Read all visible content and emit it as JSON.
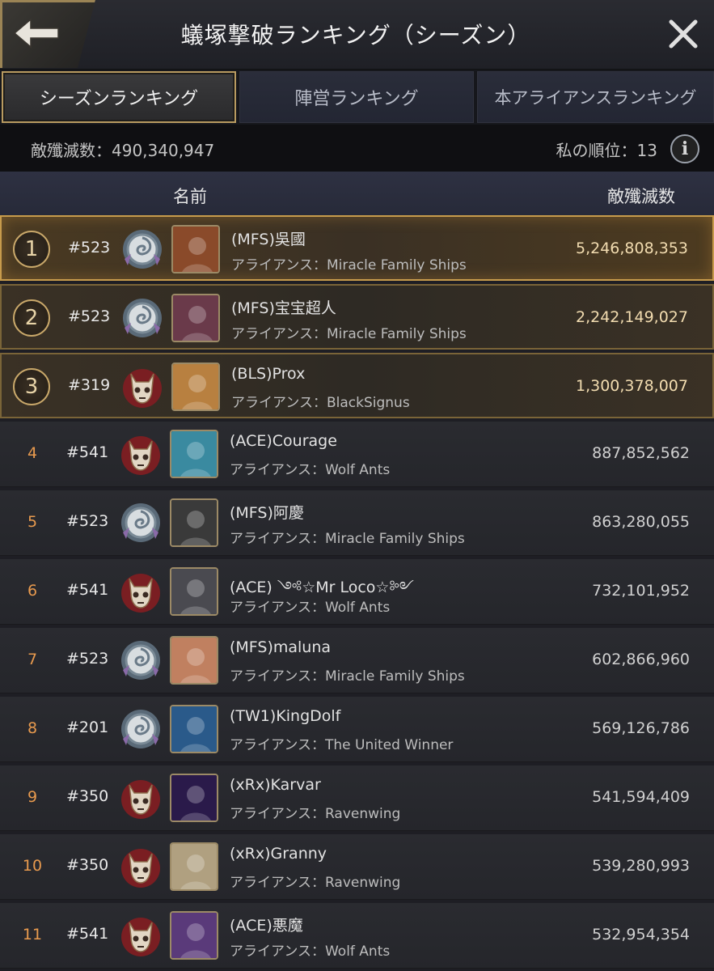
{
  "header": {
    "title": "蟻塚撃破ランキング（シーズン）",
    "back_icon": "arrow-left-icon",
    "close_icon": "close-icon"
  },
  "tabs": [
    {
      "label": "シーズンランキング",
      "active": true
    },
    {
      "label": "陣営ランキング",
      "active": false
    },
    {
      "label": "本アライアンスランキング",
      "active": false
    }
  ],
  "summary": {
    "kills_total": "敵殲滅数：490,340,947",
    "my_rank": "私の順位：13",
    "info_icon_text": "i"
  },
  "columns": {
    "name": "名前",
    "kills": "敵殲滅数"
  },
  "rows": [
    {
      "rank": "1",
      "server": "#523",
      "badge": "shell",
      "avatar_color": "#8a4a2a",
      "name": "(MFS)吳國",
      "alliance": "アライアンス：Miracle Family Ships",
      "kills": "5,246,808,353"
    },
    {
      "rank": "2",
      "server": "#523",
      "badge": "shell",
      "avatar_color": "#6a3a4a",
      "name": "(MFS)宝宝超人",
      "alliance": "アライアンス：Miracle Family Ships",
      "kills": "2,242,149,027"
    },
    {
      "rank": "3",
      "server": "#319",
      "badge": "skull",
      "avatar_color": "#b88040",
      "name": "(BLS)Prox",
      "alliance": "アライアンス：BlackSignus",
      "kills": "1,300,378,007"
    },
    {
      "rank": "4",
      "server": "#541",
      "badge": "skull",
      "avatar_color": "#3a8aa0",
      "name": "(ACE)Courage",
      "alliance": "アライアンス：Wolf Ants",
      "kills": "887,852,562"
    },
    {
      "rank": "5",
      "server": "#523",
      "badge": "shell",
      "avatar_color": "#3a3a3a",
      "name": "(MFS)阿慶",
      "alliance": "アライアンス：Miracle Family Ships",
      "kills": "863,280,055"
    },
    {
      "rank": "6",
      "server": "#541",
      "badge": "skull",
      "avatar_color": "#4a4a50",
      "name": "(ACE) ༺☆Mr Loco☆༻",
      "alliance": "アライアンス：Wolf Ants",
      "kills": "732,101,952"
    },
    {
      "rank": "7",
      "server": "#523",
      "badge": "shell",
      "avatar_color": "#c08060",
      "name": "(MFS)maluna",
      "alliance": "アライアンス：Miracle Family Ships",
      "kills": "602,866,960"
    },
    {
      "rank": "8",
      "server": "#201",
      "badge": "shell",
      "avatar_color": "#2a5a8a",
      "name": "(TW1)KingDolf",
      "alliance": "アライアンス：The United Winner",
      "kills": "569,126,786"
    },
    {
      "rank": "9",
      "server": "#350",
      "badge": "skull",
      "avatar_color": "#2a1a4a",
      "name": "(xRx)Karvar",
      "alliance": "アライアンス：Ravenwing",
      "kills": "541,594,409"
    },
    {
      "rank": "10",
      "server": "#350",
      "badge": "skull",
      "avatar_color": "#b0a080",
      "name": "(xRx)Granny",
      "alliance": "アライアンス：Ravenwing",
      "kills": "539,280,993"
    },
    {
      "rank": "11",
      "server": "#541",
      "badge": "skull",
      "avatar_color": "#5a3a7a",
      "name": "(ACE)悪魔",
      "alliance": "アライアンス：Wolf Ants",
      "kills": "532,954,354"
    }
  ]
}
